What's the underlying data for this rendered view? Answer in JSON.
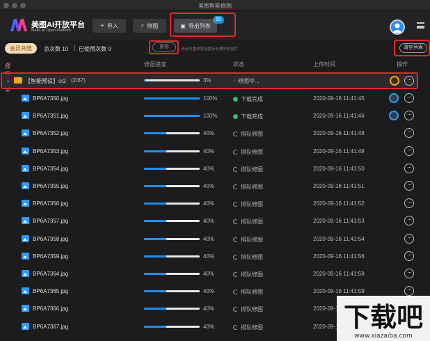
{
  "window": {
    "title": "美图智能修图"
  },
  "header": {
    "brand": "美图AI开放平台",
    "brand_sub": "Meitu AI Open Platform",
    "import_label": "导入",
    "retouch_label": "修图",
    "export_label": "导出列表",
    "export_badge": "65"
  },
  "infobar": {
    "vip_label": "会员充值",
    "total_label": "总次数 10",
    "used_label": "已使用次数 0",
    "retry_label": "重修",
    "hint": "请点击重修按钮重新处理失败图片",
    "clear_label": "清空列表"
  },
  "columns": {
    "dir": "修图目录",
    "progress": "修图进度",
    "status": "状态",
    "time": "上传时间",
    "action": "操作"
  },
  "group": {
    "name": "【智能预设】cr2",
    "count": "(2/67)",
    "progress": 0.03,
    "pct": "3%",
    "status": "修图中..."
  },
  "rows": [
    {
      "name": "BP6A7350.jpg",
      "progress": 1.0,
      "pct": "100%",
      "status": "下载完成",
      "done": true,
      "time": "2020-09-16 11:41:45"
    },
    {
      "name": "BP6A7351.jpg",
      "progress": 1.0,
      "pct": "100%",
      "status": "下载完成",
      "done": true,
      "time": "2020-09-16 11:41:46"
    },
    {
      "name": "BP6A7352.jpg",
      "progress": 0.4,
      "pct": "40%",
      "status": "排队修图",
      "done": false,
      "time": "2020-09-16 11:41:48"
    },
    {
      "name": "BP6A7353.jpg",
      "progress": 0.4,
      "pct": "40%",
      "status": "排队修图",
      "done": false,
      "time": "2020-09-16 11:41:49"
    },
    {
      "name": "BP6A7354.jpg",
      "progress": 0.4,
      "pct": "40%",
      "status": "排队修图",
      "done": false,
      "time": "2020-09-16 11:41:50"
    },
    {
      "name": "BP6A7355.jpg",
      "progress": 0.4,
      "pct": "40%",
      "status": "排队修图",
      "done": false,
      "time": "2020-09-16 11:41:51"
    },
    {
      "name": "BP6A7356.jpg",
      "progress": 0.4,
      "pct": "40%",
      "status": "排队修图",
      "done": false,
      "time": "2020-09-16 11:41:52"
    },
    {
      "name": "BP6A7357.jpg",
      "progress": 0.4,
      "pct": "40%",
      "status": "排队修图",
      "done": false,
      "time": "2020-09-16 11:41:53"
    },
    {
      "name": "BP6A7358.jpg",
      "progress": 0.4,
      "pct": "40%",
      "status": "排队修图",
      "done": false,
      "time": "2020-09-16 11:41:54"
    },
    {
      "name": "BP6A7359.jpg",
      "progress": 0.4,
      "pct": "40%",
      "status": "排队修图",
      "done": false,
      "time": "2020-09-16 11:41:56"
    },
    {
      "name": "BP6A7364.jpg",
      "progress": 0.4,
      "pct": "40%",
      "status": "排队修图",
      "done": false,
      "time": "2020-09-16 11:41:58"
    },
    {
      "name": "BP6A7365.jpg",
      "progress": 0.4,
      "pct": "40%",
      "status": "排队修图",
      "done": false,
      "time": "2020-09-16 11:41:59"
    },
    {
      "name": "BP6A7366.jpg",
      "progress": 0.4,
      "pct": "40%",
      "status": "排队修图",
      "done": false,
      "time": "2020-09-16 11:42:00"
    },
    {
      "name": "BP6A7367.jpg",
      "progress": 0.4,
      "pct": "40%",
      "status": "排队修图",
      "done": false,
      "time": "2020-09-16 11:42:01"
    }
  ],
  "watermark": {
    "text": "下载吧",
    "url": "www.xiazaiba.com"
  }
}
